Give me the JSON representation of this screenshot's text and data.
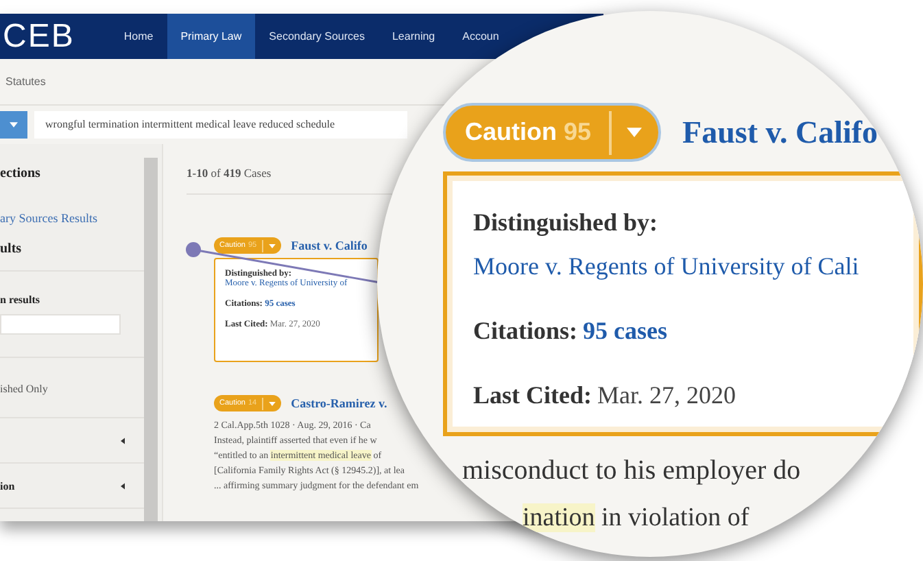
{
  "nav": {
    "logo": "CEB",
    "items": [
      {
        "label": "Home",
        "selected": false
      },
      {
        "label": "Primary Law",
        "selected": true
      },
      {
        "label": "Secondary Sources",
        "selected": false
      },
      {
        "label": "Learning",
        "selected": false
      },
      {
        "label": "Accoun",
        "selected": false
      }
    ]
  },
  "breadcrumb": "Statutes",
  "search": {
    "value": "wrongful termination intermittent medical leave reduced schedule"
  },
  "sidebar": {
    "items": [
      {
        "kind": "heading",
        "text": "ections"
      },
      {
        "kind": "link",
        "text": "ary Sources Results"
      },
      {
        "kind": "heading",
        "text": "ults"
      },
      {
        "kind": "label",
        "text": "n results"
      },
      {
        "kind": "field"
      },
      {
        "kind": "option",
        "text": "ished Only"
      },
      {
        "kind": "collapsible",
        "expanded": false
      },
      {
        "kind": "collapsible",
        "text": "ion",
        "expanded": false
      }
    ]
  },
  "results": {
    "count": "**1-10** of **419** Cases",
    "cases": [
      {
        "badge": {
          "label": "Caution",
          "count": "95"
        },
        "title": "Faust v. Califo",
        "card": {
          "distinguished_label": "Distinguished by:",
          "distinguished_link": "Moore v. Regents of University of",
          "citations_label": "Citations:",
          "citations_link": "95 cases",
          "last_cited_label": "Last Cited:",
          "last_cited": "Mar. 27, 2020"
        }
      },
      {
        "badge": {
          "label": "Caution",
          "count": "14"
        },
        "title": "Castro-Ramirez v.",
        "meta": "2 Cal.App.5th 1028 · Aug. 29, 2016 · Ca",
        "snippet": [
          {
            "segments": [
              {
                "text": "Instead, plaintiff asserted that even if he w",
                "highlight": false
              }
            ]
          },
          {
            "segments": [
              {
                "text": "“entitled to an ",
                "highlight": false
              },
              {
                "text": "intermittent medical leave",
                "highlight": true
              },
              {
                "text": " of",
                "highlight": false
              }
            ]
          },
          {
            "segments": [
              {
                "text": "[California Family Rights Act (§ 12945.2)], at lea",
                "highlight": false
              }
            ]
          },
          {
            "segments": [
              {
                "text": "... affirming summary judgment for the defendant em",
                "highlight": false
              }
            ]
          }
        ]
      }
    ]
  },
  "magnifier": {
    "badge": {
      "label": "Caution",
      "count": "95"
    },
    "title": "Faust v. Califo",
    "card": {
      "distinguished_label": "Distinguished by:",
      "distinguished_link": "Moore v. Regents of University of Cali",
      "citations_label": "Citations:",
      "citations_link": "95 cases",
      "last_cited_label": "Last Cited:",
      "last_cited": "Mar. 27, 2020"
    },
    "snippet": [
      {
        "segments": [
          {
            "text": "misconduct to his employer do",
            "highlight": false
          }
        ]
      },
      {
        "segments": [
          {
            "text": "ination",
            "highlight": true
          },
          {
            "text": " in violation of",
            "highlight": false
          }
        ]
      }
    ]
  }
}
